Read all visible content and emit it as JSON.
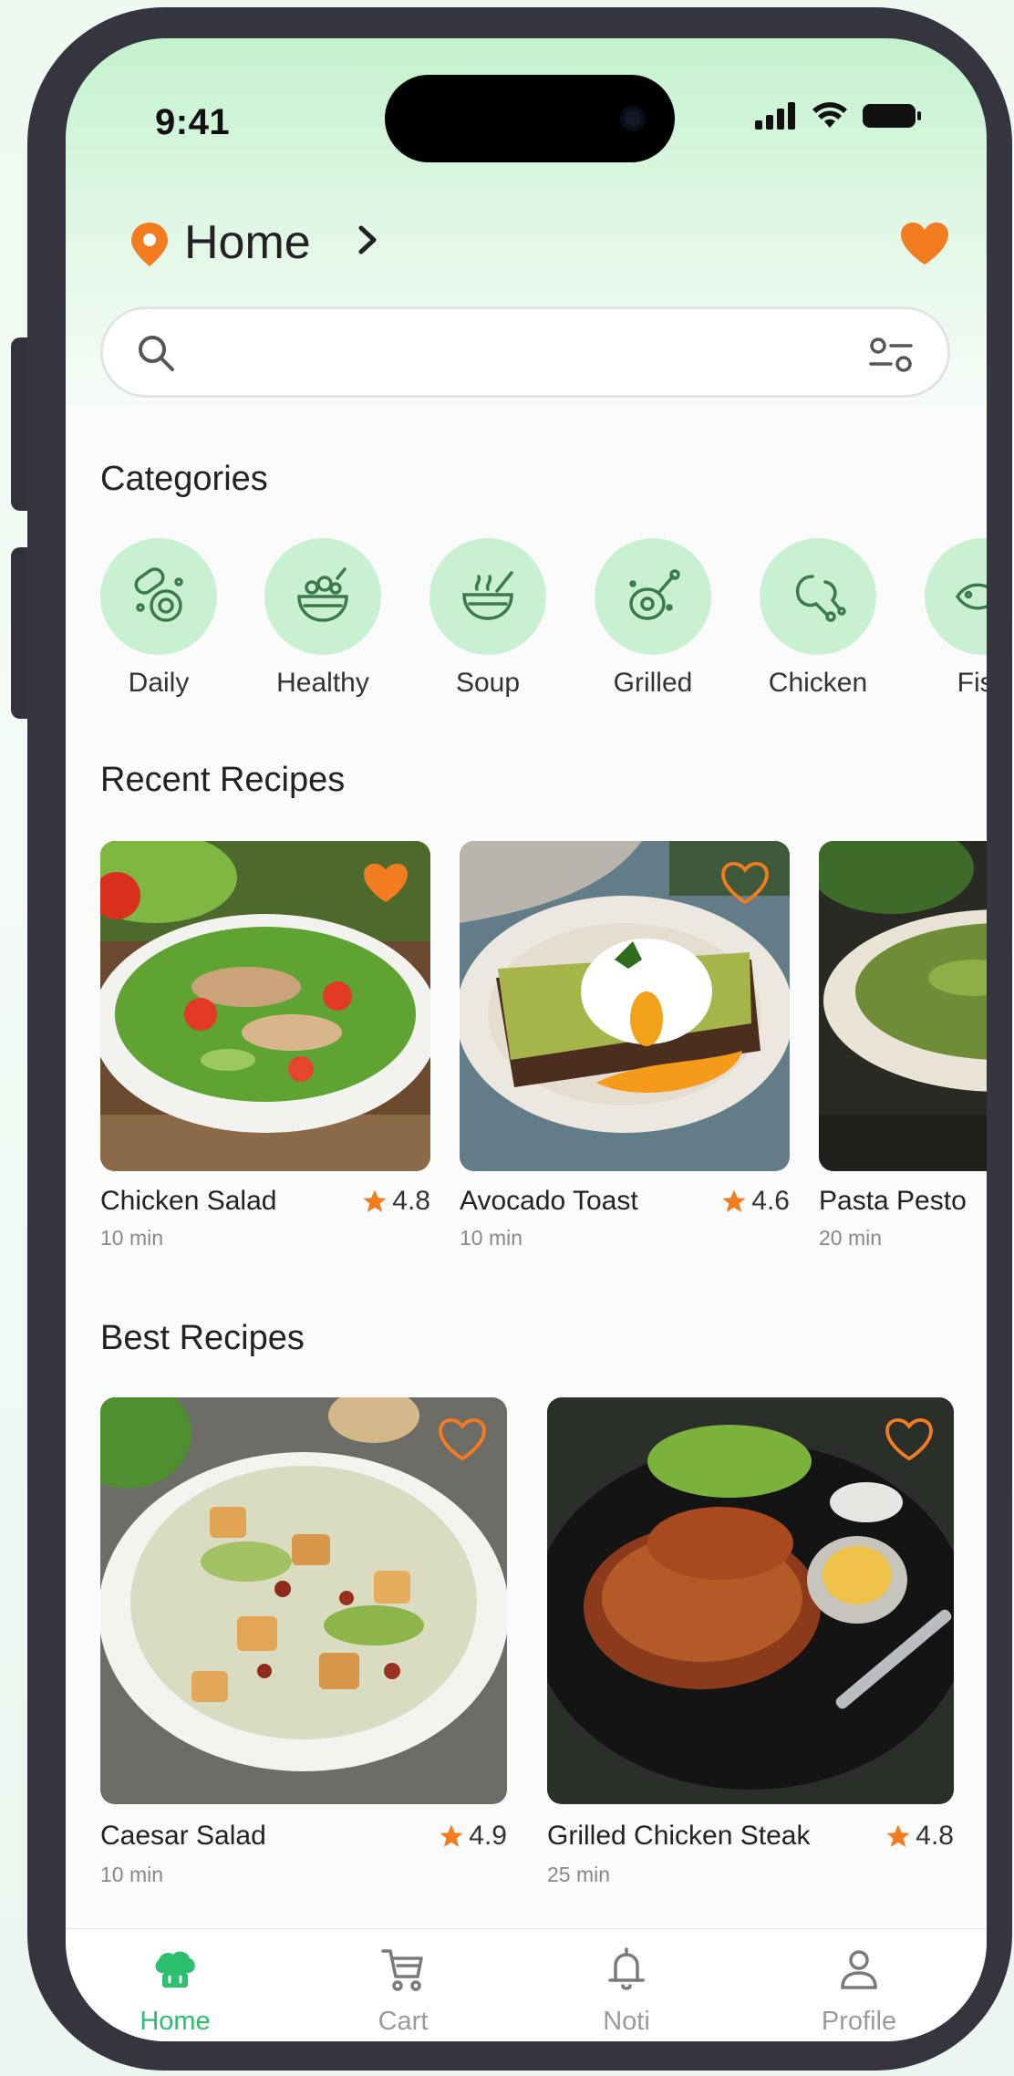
{
  "status": {
    "time": "9:41"
  },
  "header": {
    "location": "Home"
  },
  "search": {
    "placeholder": ""
  },
  "sections": {
    "categories": "Categories",
    "recent": "Recent Recipes",
    "best": "Best Recipes"
  },
  "categories": [
    {
      "label": "Daily",
      "icon": "daily-food-icon"
    },
    {
      "label": "Healthy",
      "icon": "salad-bowl-icon"
    },
    {
      "label": "Soup",
      "icon": "soup-bowl-icon"
    },
    {
      "label": "Grilled",
      "icon": "grilled-meat-icon"
    },
    {
      "label": "Chicken",
      "icon": "chicken-leg-icon"
    },
    {
      "label": "Fish",
      "icon": "fish-icon"
    }
  ],
  "recent": [
    {
      "name": "Chicken Salad",
      "rating": "4.8",
      "time": "10 min",
      "favorite": true
    },
    {
      "name": "Avocado Toast",
      "rating": "4.6",
      "time": "10 min",
      "favorite": false
    },
    {
      "name": "Pasta Pesto",
      "rating": "",
      "time": "20 min",
      "favorite": false
    }
  ],
  "best": [
    {
      "name": "Caesar Salad",
      "rating": "4.9",
      "time": "10 min",
      "favorite": false
    },
    {
      "name": "Grilled Chicken Steak",
      "rating": "4.8",
      "time": "25 min",
      "favorite": false
    }
  ],
  "nav": [
    {
      "label": "Home",
      "active": true
    },
    {
      "label": "Cart",
      "active": false
    },
    {
      "label": "Noti",
      "active": false
    },
    {
      "label": "Profile",
      "active": false
    }
  ],
  "colors": {
    "accent": "#2bbf6f",
    "orange": "#f47c20",
    "category_bg": "#c9f1d1",
    "icon_green": "#3c7a4d"
  }
}
